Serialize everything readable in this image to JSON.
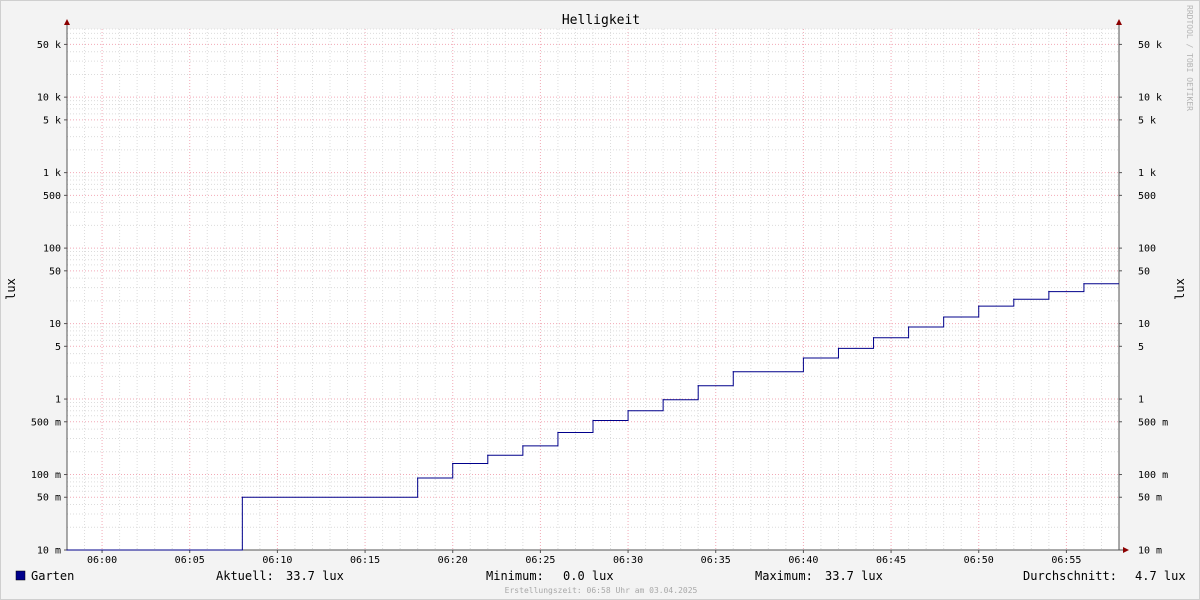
{
  "chart_data": {
    "type": "line",
    "title": "Helligkeit",
    "ylabel": "lux",
    "y_scale": "log",
    "ylim": [
      0.01,
      80000
    ],
    "y_ticks": [
      {
        "value": 0.01,
        "label": "10 m"
      },
      {
        "value": 0.05,
        "label": "50 m"
      },
      {
        "value": 0.1,
        "label": "100 m"
      },
      {
        "value": 0.5,
        "label": "500 m"
      },
      {
        "value": 1,
        "label": "1"
      },
      {
        "value": 5,
        "label": "5"
      },
      {
        "value": 10,
        "label": "10"
      },
      {
        "value": 50,
        "label": "50"
      },
      {
        "value": 100,
        "label": "100"
      },
      {
        "value": 500,
        "label": "500"
      },
      {
        "value": 1000,
        "label": "1 k"
      },
      {
        "value": 5000,
        "label": "5 k"
      },
      {
        "value": 10000,
        "label": "10 k"
      },
      {
        "value": 50000,
        "label": "50 k"
      }
    ],
    "xlim": [
      "05:58",
      "05:58"
    ],
    "x_range_minutes": [
      -2,
      58
    ],
    "x_ticks": [
      "06:00",
      "06:05",
      "06:10",
      "06:15",
      "06:20",
      "06:25",
      "06:30",
      "06:35",
      "06:40",
      "06:45",
      "06:50",
      "06:55"
    ],
    "grid": true,
    "color": "#00008b",
    "series": [
      {
        "name": "Garten",
        "color": "#00008b",
        "points": [
          {
            "x": "05:58",
            "y": 0.01
          },
          {
            "x": "06:08",
            "y": 0.05
          },
          {
            "x": "06:18",
            "y": 0.09
          },
          {
            "x": "06:20",
            "y": 0.14
          },
          {
            "x": "06:22",
            "y": 0.18
          },
          {
            "x": "06:24",
            "y": 0.24
          },
          {
            "x": "06:26",
            "y": 0.36
          },
          {
            "x": "06:28",
            "y": 0.52
          },
          {
            "x": "06:30",
            "y": 0.7
          },
          {
            "x": "06:32",
            "y": 0.98
          },
          {
            "x": "06:34",
            "y": 1.5
          },
          {
            "x": "06:36",
            "y": 2.3
          },
          {
            "x": "06:40",
            "y": 3.5
          },
          {
            "x": "06:42",
            "y": 4.7
          },
          {
            "x": "06:44",
            "y": 6.5
          },
          {
            "x": "06:46",
            "y": 9.0
          },
          {
            "x": "06:48",
            "y": 12.2
          },
          {
            "x": "06:50",
            "y": 17.0
          },
          {
            "x": "06:52",
            "y": 21.0
          },
          {
            "x": "06:54",
            "y": 26.5
          },
          {
            "x": "06:56",
            "y": 33.7
          }
        ]
      }
    ],
    "legend": {
      "placement": "bottom-left",
      "series_name": "Garten"
    },
    "stats": {
      "current_label": "Aktuell:",
      "current_value": "33.7 lux",
      "min_label": "Minimum:",
      "min_value": "0.0 lux",
      "max_label": "Maximum:",
      "max_value": "33.7 lux",
      "avg_label": "Durchschnitt:",
      "avg_value": "4.7 lux"
    },
    "watermark": "RRDTOOL / TOBI OETIKER",
    "footer": "Erstellungszeit: 06:58 Uhr am 03.04.2025"
  }
}
